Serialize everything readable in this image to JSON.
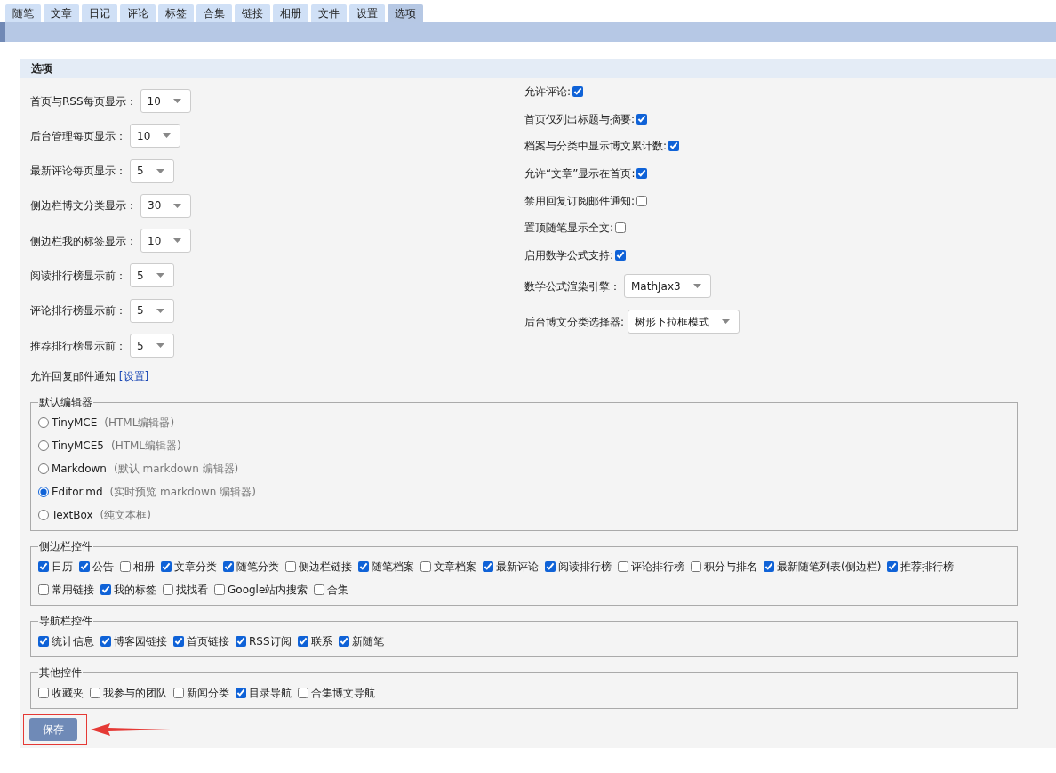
{
  "tabs": [
    {
      "label": "随笔",
      "selected": false
    },
    {
      "label": "文章",
      "selected": false
    },
    {
      "label": "日记",
      "selected": false
    },
    {
      "label": "评论",
      "selected": false
    },
    {
      "label": "标签",
      "selected": false
    },
    {
      "label": "合集",
      "selected": false
    },
    {
      "label": "链接",
      "selected": false
    },
    {
      "label": "相册",
      "selected": false
    },
    {
      "label": "文件",
      "selected": false
    },
    {
      "label": "设置",
      "selected": false
    },
    {
      "label": "选项",
      "selected": true
    }
  ],
  "panel": {
    "title": "选项"
  },
  "display_settings": [
    {
      "label": "首页与RSS每页显示：",
      "value": "10"
    },
    {
      "label": "后台管理每页显示：",
      "value": "10"
    },
    {
      "label": "最新评论每页显示：",
      "value": "5"
    },
    {
      "label": "侧边栏博文分类显示：",
      "value": "30"
    },
    {
      "label": "侧边栏我的标签显示：",
      "value": "10"
    },
    {
      "label": "阅读排行榜显示前：",
      "value": "5"
    },
    {
      "label": "评论排行榜显示前：",
      "value": "5"
    },
    {
      "label": "推荐排行榜显示前：",
      "value": "5"
    }
  ],
  "reply_notice": {
    "text": "允许回复邮件通知",
    "link": "[设置]"
  },
  "toggles": [
    {
      "label": "允许评论:",
      "checked": true
    },
    {
      "label": "首页仅列出标题与摘要:",
      "checked": true
    },
    {
      "label": "档案与分类中显示博文累计数:",
      "checked": true
    },
    {
      "label": "允许“文章”显示在首页:",
      "checked": true
    },
    {
      "label": "禁用回复订阅邮件通知:",
      "checked": false
    },
    {
      "label": "置顶随笔显示全文:",
      "checked": false
    },
    {
      "label": "启用数学公式支持:",
      "checked": true
    }
  ],
  "right_selects": [
    {
      "label": "数学公式渲染引擎：",
      "value": "MathJax3"
    },
    {
      "label": "后台博文分类选择器:",
      "value": "树形下拉框模式"
    }
  ],
  "editor": {
    "legend": "默认编辑器",
    "options": [
      {
        "name": "TinyMCE",
        "note": "(HTML编辑器)",
        "selected": false
      },
      {
        "name": "TinyMCE5",
        "note": "(HTML编辑器)",
        "selected": false
      },
      {
        "name": "Markdown",
        "note": "(默认 markdown 编辑器)",
        "selected": false
      },
      {
        "name": "Editor.md",
        "note": "(实时预览 markdown 编辑器)",
        "selected": true
      },
      {
        "name": "TextBox",
        "note": "(纯文本框)",
        "selected": false
      }
    ]
  },
  "sidebar_controls": {
    "legend": "侧边栏控件",
    "items": [
      {
        "label": "日历",
        "checked": true
      },
      {
        "label": "公告",
        "checked": true
      },
      {
        "label": "相册",
        "checked": false
      },
      {
        "label": "文章分类",
        "checked": true
      },
      {
        "label": "随笔分类",
        "checked": true
      },
      {
        "label": "侧边栏链接",
        "checked": false
      },
      {
        "label": "随笔档案",
        "checked": true
      },
      {
        "label": "文章档案",
        "checked": false
      },
      {
        "label": "最新评论",
        "checked": true
      },
      {
        "label": "阅读排行榜",
        "checked": true
      },
      {
        "label": "评论排行榜",
        "checked": false
      },
      {
        "label": "积分与排名",
        "checked": false
      },
      {
        "label": "最新随笔列表(侧边栏)",
        "checked": true
      },
      {
        "label": "推荐排行榜",
        "checked": true
      },
      {
        "label": "常用链接",
        "checked": false
      },
      {
        "label": "我的标签",
        "checked": true
      },
      {
        "label": "找找看",
        "checked": false
      },
      {
        "label": "Google站内搜索",
        "checked": false
      },
      {
        "label": "合集",
        "checked": false
      }
    ]
  },
  "nav_controls": {
    "legend": "导航栏控件",
    "items": [
      {
        "label": "统计信息",
        "checked": true
      },
      {
        "label": "博客园链接",
        "checked": true
      },
      {
        "label": "首页链接",
        "checked": true
      },
      {
        "label": "RSS订阅",
        "checked": true
      },
      {
        "label": "联系",
        "checked": true
      },
      {
        "label": "新随笔",
        "checked": true
      }
    ]
  },
  "other_controls": {
    "legend": "其他控件",
    "items": [
      {
        "label": "收藏夹",
        "checked": false
      },
      {
        "label": "我参与的团队",
        "checked": false
      },
      {
        "label": "新闻分类",
        "checked": false
      },
      {
        "label": "目录导航",
        "checked": true
      },
      {
        "label": "合集博文导航",
        "checked": false
      }
    ]
  },
  "save": {
    "label": "保存",
    "highlighted": true
  }
}
